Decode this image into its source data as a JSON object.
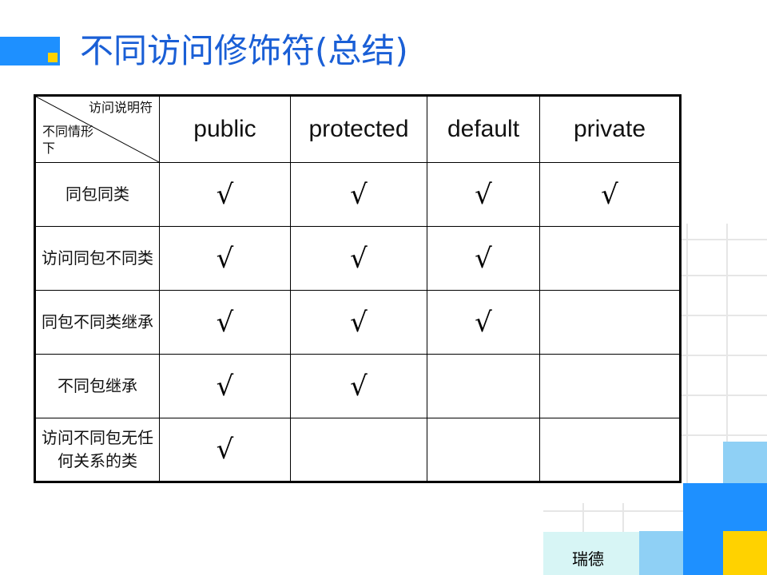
{
  "slide": {
    "title": "不同访问修饰符(总结)",
    "footer_label": "瑞德"
  },
  "table": {
    "corner_top": "访问说明符",
    "corner_bottom": "不同情形下",
    "columns": [
      "public",
      "protected",
      "default",
      "private"
    ],
    "check_mark": "√",
    "rows": [
      {
        "label": "同包同类",
        "checks": [
          true,
          true,
          true,
          true
        ]
      },
      {
        "label": "访问同包不同类",
        "checks": [
          true,
          true,
          true,
          false
        ]
      },
      {
        "label": "同包不同类继承",
        "checks": [
          true,
          true,
          true,
          false
        ]
      },
      {
        "label": "不同包继承",
        "checks": [
          true,
          true,
          false,
          false
        ]
      },
      {
        "label": "访问不同包无任何关系的类",
        "checks": [
          true,
          false,
          false,
          false
        ]
      }
    ]
  },
  "colors": {
    "title_text": "#1a5fd6",
    "accent_blue": "#1e90ff",
    "accent_yellow": "#ffd200",
    "light_cyan": "#d7f5f5"
  }
}
